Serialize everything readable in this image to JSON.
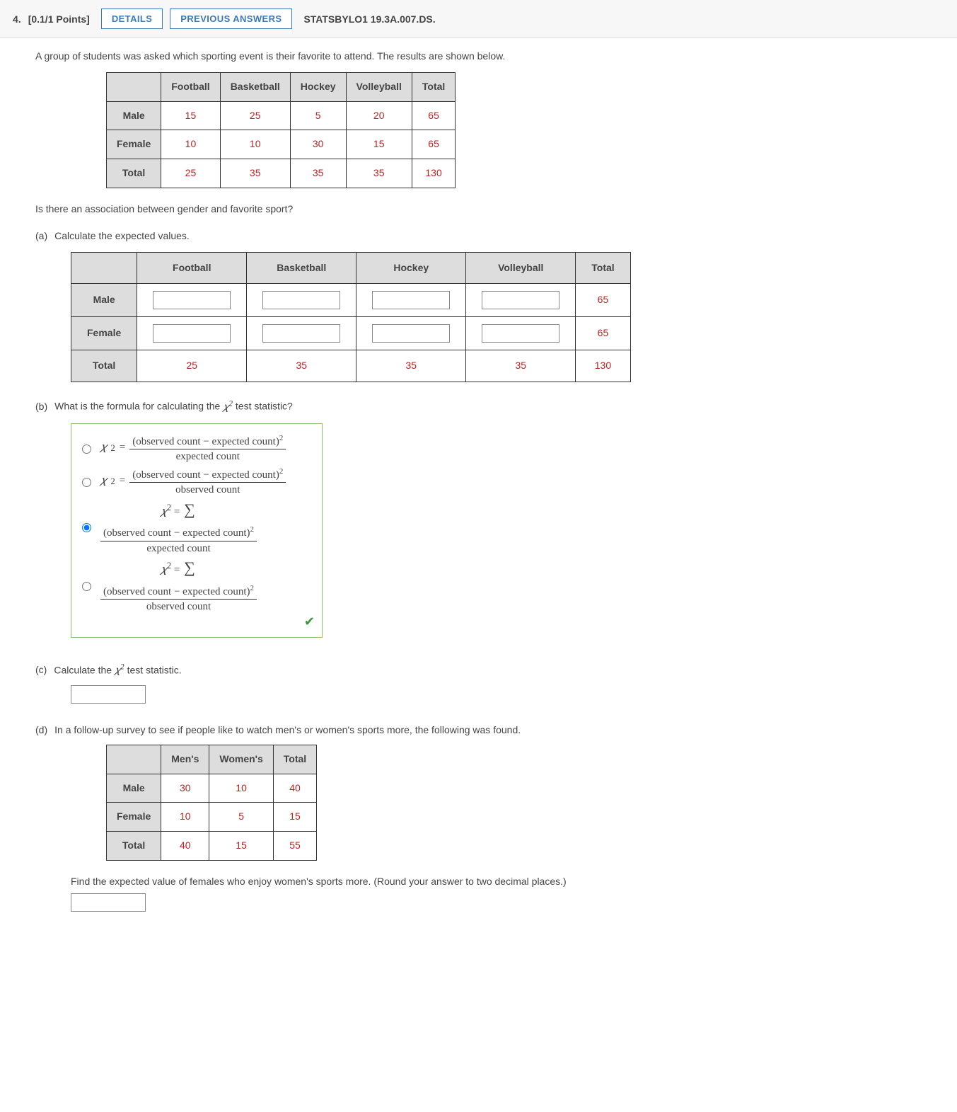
{
  "header": {
    "qnum": "4.",
    "points": "[0.1/1 Points]",
    "details_btn": "DETAILS",
    "prev_btn": "PREVIOUS ANSWERS",
    "qref": "STATSBYLO1 19.3A.007.DS."
  },
  "prompt": "A group of students was asked which sporting event is their favorite to attend. The results are shown below.",
  "t1": {
    "cols": [
      "Football",
      "Basketball",
      "Hockey",
      "Volleyball",
      "Total"
    ],
    "rows": [
      {
        "label": "Male",
        "vals": [
          "15",
          "25",
          "5",
          "20",
          "65"
        ]
      },
      {
        "label": "Female",
        "vals": [
          "10",
          "10",
          "30",
          "15",
          "65"
        ]
      },
      {
        "label": "Total",
        "vals": [
          "25",
          "35",
          "35",
          "35",
          "130"
        ]
      }
    ]
  },
  "q2": "Is there an association between gender and favorite sport?",
  "parts": {
    "a": "Calculate the expected values.",
    "b": "What is the formula for calculating the ",
    "b_tail": " test statistic?",
    "c_lead": "Calculate the ",
    "c_tail": " test statistic.",
    "d": "In a follow-up survey to see if people like to watch men's or women's sports more, the following was found.",
    "d2": "Find the expected value of females who enjoy women's sports more. (Round your answer to two decimal places.)"
  },
  "tExp": {
    "cols": [
      "Football",
      "Basketball",
      "Hockey",
      "Volleyball",
      "Total"
    ],
    "r1": {
      "label": "Male",
      "total": "65"
    },
    "r2": {
      "label": "Female",
      "total": "65"
    },
    "r3": {
      "label": "Total",
      "vals": [
        "25",
        "35",
        "35",
        "35",
        "130"
      ]
    }
  },
  "chi_label": "𝜒²",
  "formulas": {
    "num": "(observed count − expected count)",
    "den_exp": "expected count",
    "den_obs": "observed count"
  },
  "t3": {
    "cols": [
      "Men's",
      "Women's",
      "Total"
    ],
    "rows": [
      {
        "label": "Male",
        "vals": [
          "30",
          "10",
          "40"
        ]
      },
      {
        "label": "Female",
        "vals": [
          "10",
          "5",
          "15"
        ]
      },
      {
        "label": "Total",
        "vals": [
          "40",
          "15",
          "55"
        ]
      }
    ]
  }
}
